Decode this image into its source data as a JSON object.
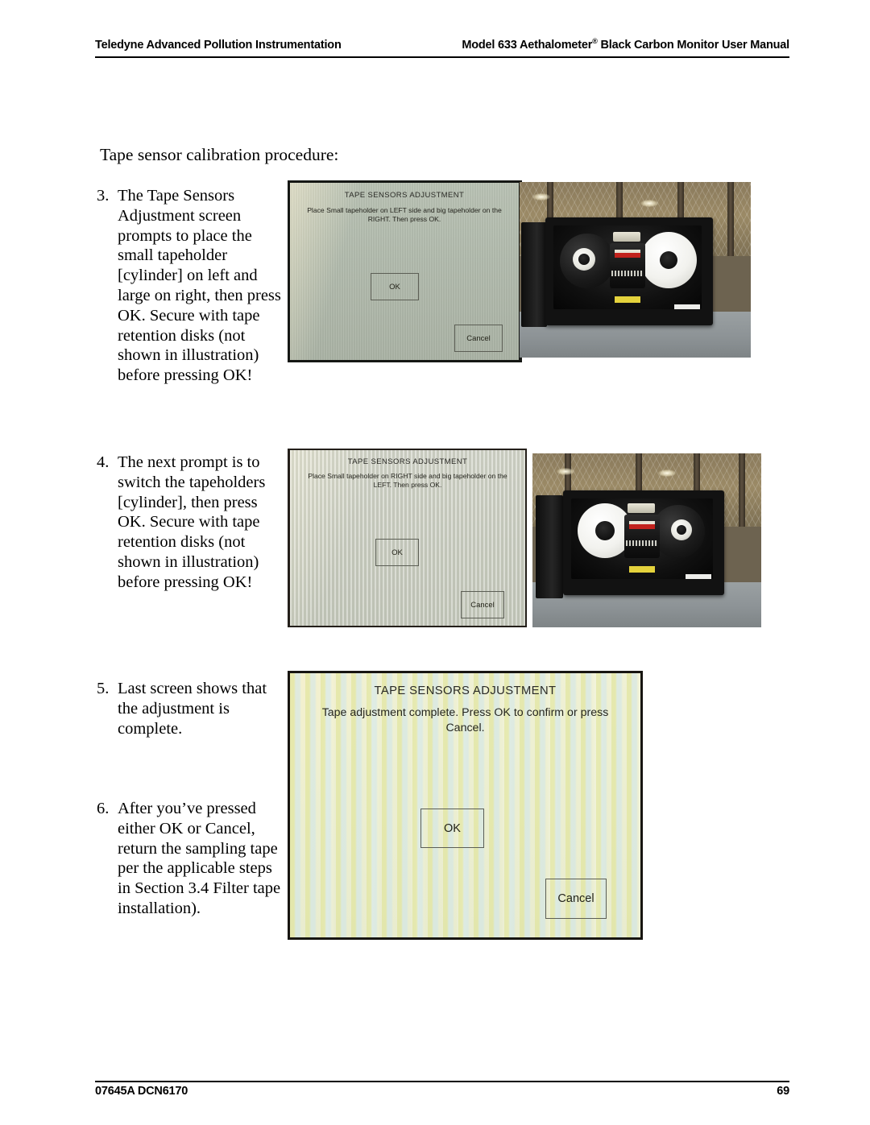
{
  "header": {
    "left": "Teledyne Advanced Pollution Instrumentation",
    "right_pre": "Model 633 Aethalometer",
    "right_sup": "®",
    "right_post": " Black Carbon Monitor User Manual"
  },
  "footer": {
    "doc_number": "07645A DCN6170",
    "page_number": "69"
  },
  "content": {
    "intro": "Tape sensor calibration procedure:",
    "steps": [
      {
        "number": "3.",
        "text": "The Tape Sensors Adjustment screen prompts to place the small tapeholder [cylinder] on left and large on right, then press OK. Secure with tape retention disks (not shown in illustration) before pressing OK!"
      },
      {
        "number": "4.",
        "text": "The next prompt is to switch the tapeholders [cylinder], then press OK. Secure with tape retention disks (not shown in illustration) before pressing OK!"
      },
      {
        "number": "5.",
        "text": "Last screen shows that the adjustment is complete."
      },
      {
        "number": "6.",
        "text": "After you’ve pressed either OK or Cancel, return the sampling tape per the applicable steps in Section 3.4 Filter tape installation)."
      }
    ]
  },
  "figures": {
    "dialog_1": {
      "title": "TAPE SENSORS ADJUSTMENT",
      "message": "Place Small tapeholder on LEFT side and big tapeholder on the RIGHT. Then press OK.",
      "ok_label": "OK",
      "cancel_label": "Cancel",
      "screen_color": "#b2bbad"
    },
    "dialog_2": {
      "title": "TAPE SENSORS ADJUSTMENT",
      "message": "Place Small tapeholder on RIGHT side and big tapeholder on the LEFT. Then press OK.",
      "ok_label": "OK",
      "cancel_label": "Cancel",
      "screen_color": "#cdd0c4"
    },
    "dialog_3": {
      "title": "TAPE SENSORS ADJUSTMENT",
      "message": "Tape adjustment complete. Press OK to confirm or press Cancel.",
      "ok_label": "OK",
      "cancel_label": "Cancel",
      "screen_color": "#e9ecd3"
    },
    "photo_1": {
      "caption_role": "Instrument interior: small tapeholder on LEFT, large tapeholder on RIGHT"
    },
    "photo_2": {
      "caption_role": "Instrument interior: large tapeholder on LEFT, small tapeholder on RIGHT"
    }
  }
}
